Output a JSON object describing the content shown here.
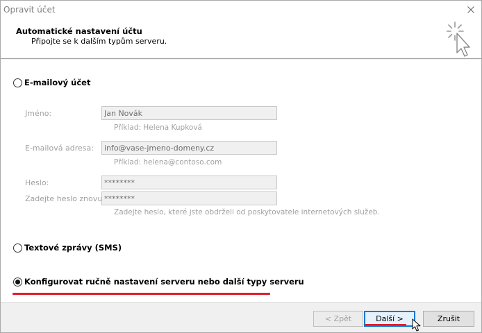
{
  "window": {
    "title": "Opravit účet"
  },
  "header": {
    "title": "Automatické nastavení účtu",
    "subtitle": "Připojte se k dalším typům serveru."
  },
  "options": {
    "email_account": {
      "label": "E-mailový účet",
      "selected": false
    },
    "sms": {
      "label": "Textové zprávy (SMS)",
      "selected": false
    },
    "manual": {
      "label": "Konfigurovat ručně nastavení serveru nebo další typy serveru",
      "selected": true
    }
  },
  "form": {
    "name": {
      "label": "Jméno:",
      "value": "Jan Novák",
      "hint": "Příklad: Helena Kupková"
    },
    "email": {
      "label": "E-mailová adresa:",
      "value": "info@vase-jmeno-domeny.cz",
      "hint": "Příklad: helena@contoso.com"
    },
    "password": {
      "label": "Heslo:",
      "value": "********"
    },
    "password_repeat": {
      "label": "Zadejte heslo znovu:",
      "value": "********",
      "hint": "Zadejte heslo, které jste obdrželi od poskytovatele internetových služeb."
    }
  },
  "buttons": {
    "back": "< Zpět",
    "next": "Další >",
    "cancel": "Zrušit"
  },
  "colors": {
    "accent": "#0078d7",
    "highlight": "#e11b2b"
  },
  "icons": {
    "close": "close-icon",
    "wizard": "wizard-cursor-icon",
    "cursor": "mouse-pointer-icon"
  }
}
